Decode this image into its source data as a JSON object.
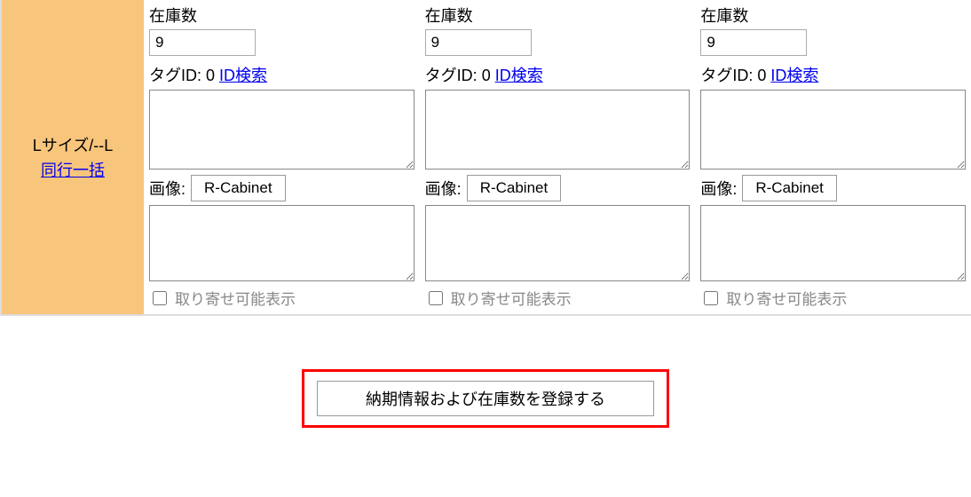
{
  "row": {
    "title": "Lサイズ/--L",
    "bulk_link": "同行一括"
  },
  "cells": [
    {
      "stock_label": "在庫数",
      "stock_value": "9",
      "tag_prefix": "タグID: ",
      "tag_value": "0",
      "tag_search_label": "ID検索",
      "image_label": "画像:",
      "cabinet_label": "R-Cabinet",
      "backorder_label": "取り寄せ可能表示"
    },
    {
      "stock_label": "在庫数",
      "stock_value": "9",
      "tag_prefix": "タグID: ",
      "tag_value": "0",
      "tag_search_label": "ID検索",
      "image_label": "画像:",
      "cabinet_label": "R-Cabinet",
      "backorder_label": "取り寄せ可能表示"
    },
    {
      "stock_label": "在庫数",
      "stock_value": "9",
      "tag_prefix": "タグID: ",
      "tag_value": "0",
      "tag_search_label": "ID検索",
      "image_label": "画像:",
      "cabinet_label": "R-Cabinet",
      "backorder_label": "取り寄せ可能表示"
    }
  ],
  "submit": {
    "label": "納期情報および在庫数を登録する"
  }
}
